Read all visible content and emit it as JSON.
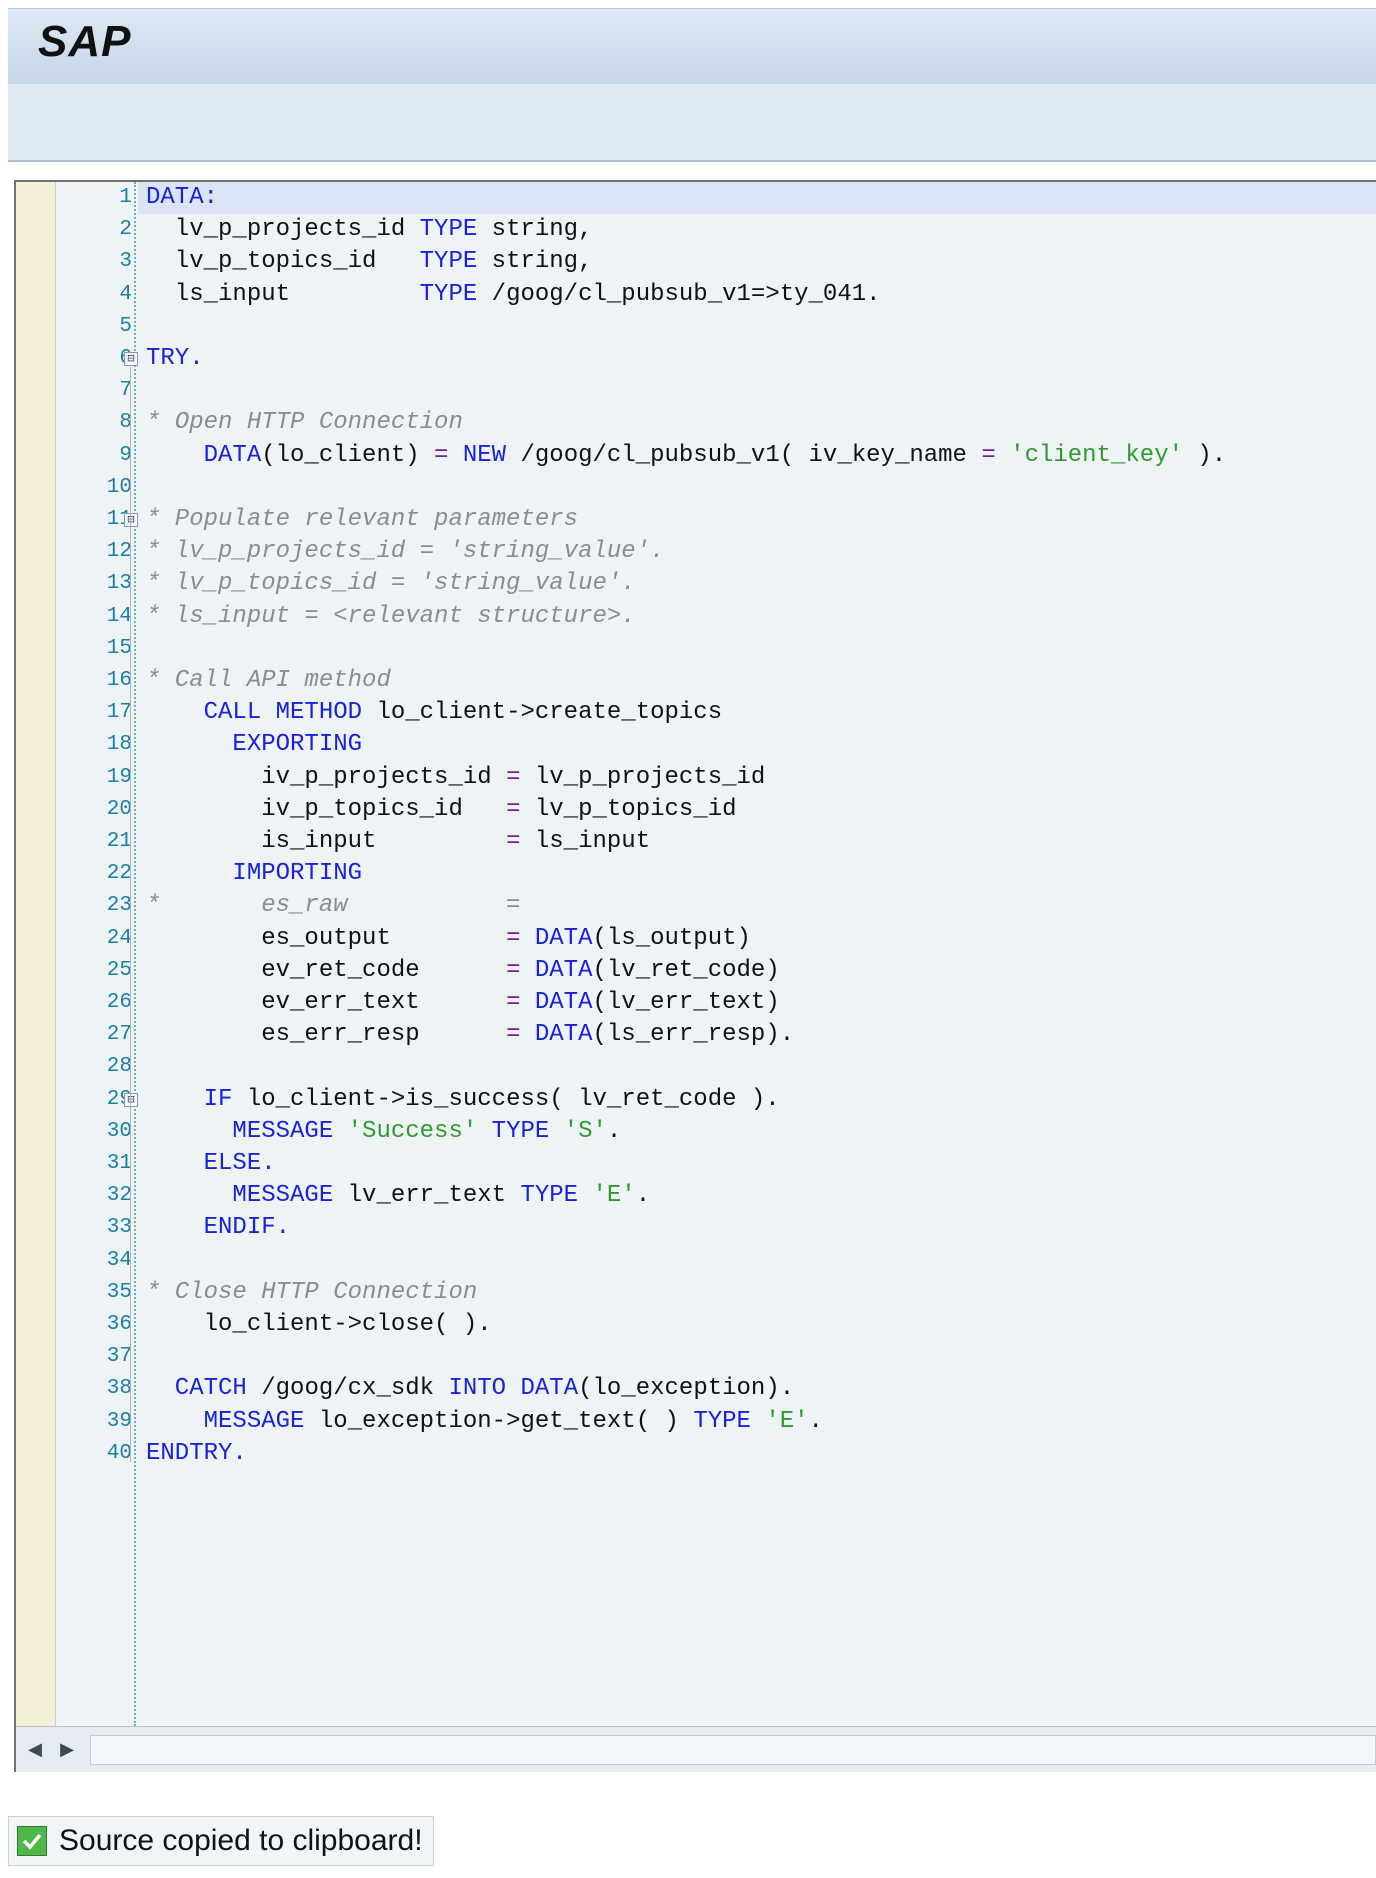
{
  "window": {
    "logo_text": "SAP"
  },
  "editor": {
    "current_line": 1,
    "lines": [
      {
        "n": "1",
        "tokens": [
          [
            "kw",
            "DATA:"
          ]
        ]
      },
      {
        "n": "2",
        "tokens": [
          [
            "id",
            "  lv_p_projects_id "
          ],
          [
            "kw",
            "TYPE"
          ],
          [
            "id",
            " string,"
          ]
        ]
      },
      {
        "n": "3",
        "tokens": [
          [
            "id",
            "  lv_p_topics_id   "
          ],
          [
            "kw",
            "TYPE"
          ],
          [
            "id",
            " string,"
          ]
        ]
      },
      {
        "n": "4",
        "tokens": [
          [
            "id",
            "  ls_input         "
          ],
          [
            "kw",
            "TYPE"
          ],
          [
            "id",
            " /goog/cl_pubsub_v1=>ty_041."
          ]
        ]
      },
      {
        "n": "5",
        "tokens": []
      },
      {
        "n": "6",
        "tokens": [
          [
            "kw",
            "TRY."
          ]
        ]
      },
      {
        "n": "7",
        "tokens": []
      },
      {
        "n": "8",
        "tokens": [
          [
            "cm",
            "* Open HTTP Connection"
          ]
        ]
      },
      {
        "n": "9",
        "tokens": [
          [
            "kw",
            "    DATA"
          ],
          [
            "id",
            "(lo_client) "
          ],
          [
            "op",
            "="
          ],
          [
            "id",
            " "
          ],
          [
            "kw",
            "NEW"
          ],
          [
            "id",
            " /goog/cl_pubsub_v1( iv_key_name "
          ],
          [
            "op",
            "="
          ],
          [
            "id",
            " "
          ],
          [
            "str",
            "'client_key'"
          ],
          [
            "id",
            " )."
          ]
        ]
      },
      {
        "n": "10",
        "tokens": []
      },
      {
        "n": "11",
        "tokens": [
          [
            "cm",
            "* Populate relevant parameters"
          ]
        ]
      },
      {
        "n": "12",
        "tokens": [
          [
            "cm",
            "* lv_p_projects_id = 'string_value'."
          ]
        ]
      },
      {
        "n": "13",
        "tokens": [
          [
            "cm",
            "* lv_p_topics_id = 'string_value'."
          ]
        ]
      },
      {
        "n": "14",
        "tokens": [
          [
            "cm",
            "* ls_input = <relevant structure>."
          ]
        ]
      },
      {
        "n": "15",
        "tokens": []
      },
      {
        "n": "16",
        "tokens": [
          [
            "cm",
            "* Call API method"
          ]
        ]
      },
      {
        "n": "17",
        "tokens": [
          [
            "kw",
            "    CALL METHOD"
          ],
          [
            "id",
            " lo_client->create_topics"
          ]
        ]
      },
      {
        "n": "18",
        "tokens": [
          [
            "kw",
            "      EXPORTING"
          ]
        ]
      },
      {
        "n": "19",
        "tokens": [
          [
            "id",
            "        iv_p_projects_id "
          ],
          [
            "op",
            "="
          ],
          [
            "id",
            " lv_p_projects_id"
          ]
        ]
      },
      {
        "n": "20",
        "tokens": [
          [
            "id",
            "        iv_p_topics_id   "
          ],
          [
            "op",
            "="
          ],
          [
            "id",
            " lv_p_topics_id"
          ]
        ]
      },
      {
        "n": "21",
        "tokens": [
          [
            "id",
            "        is_input         "
          ],
          [
            "op",
            "="
          ],
          [
            "id",
            " ls_input"
          ]
        ]
      },
      {
        "n": "22",
        "tokens": [
          [
            "kw",
            "      IMPORTING"
          ]
        ]
      },
      {
        "n": "23",
        "tokens": [
          [
            "cm",
            "*       es_raw           ="
          ]
        ]
      },
      {
        "n": "24",
        "tokens": [
          [
            "id",
            "        es_output        "
          ],
          [
            "op",
            "="
          ],
          [
            "id",
            " "
          ],
          [
            "kw",
            "DATA"
          ],
          [
            "id",
            "(ls_output)"
          ]
        ]
      },
      {
        "n": "25",
        "tokens": [
          [
            "id",
            "        ev_ret_code      "
          ],
          [
            "op",
            "="
          ],
          [
            "id",
            " "
          ],
          [
            "kw",
            "DATA"
          ],
          [
            "id",
            "(lv_ret_code)"
          ]
        ]
      },
      {
        "n": "26",
        "tokens": [
          [
            "id",
            "        ev_err_text      "
          ],
          [
            "op",
            "="
          ],
          [
            "id",
            " "
          ],
          [
            "kw",
            "DATA"
          ],
          [
            "id",
            "(lv_err_text)"
          ]
        ]
      },
      {
        "n": "27",
        "tokens": [
          [
            "id",
            "        es_err_resp      "
          ],
          [
            "op",
            "="
          ],
          [
            "id",
            " "
          ],
          [
            "kw",
            "DATA"
          ],
          [
            "id",
            "(ls_err_resp)."
          ]
        ]
      },
      {
        "n": "28",
        "tokens": []
      },
      {
        "n": "29",
        "tokens": [
          [
            "kw",
            "    IF"
          ],
          [
            "id",
            " lo_client->is_success( lv_ret_code )."
          ]
        ]
      },
      {
        "n": "30",
        "tokens": [
          [
            "kw",
            "      MESSAGE"
          ],
          [
            "id",
            " "
          ],
          [
            "str",
            "'Success'"
          ],
          [
            "id",
            " "
          ],
          [
            "kw",
            "TYPE"
          ],
          [
            "id",
            " "
          ],
          [
            "str",
            "'S'"
          ],
          [
            "id",
            "."
          ]
        ]
      },
      {
        "n": "31",
        "tokens": [
          [
            "kw",
            "    ELSE."
          ]
        ]
      },
      {
        "n": "32",
        "tokens": [
          [
            "kw",
            "      MESSAGE"
          ],
          [
            "id",
            " lv_err_text "
          ],
          [
            "kw",
            "TYPE"
          ],
          [
            "id",
            " "
          ],
          [
            "str",
            "'E'"
          ],
          [
            "id",
            "."
          ]
        ]
      },
      {
        "n": "33",
        "tokens": [
          [
            "kw",
            "    ENDIF."
          ]
        ]
      },
      {
        "n": "34",
        "tokens": []
      },
      {
        "n": "35",
        "tokens": [
          [
            "cm",
            "* Close HTTP Connection"
          ]
        ]
      },
      {
        "n": "36",
        "tokens": [
          [
            "id",
            "    lo_client->close( )."
          ]
        ]
      },
      {
        "n": "37",
        "tokens": []
      },
      {
        "n": "38",
        "tokens": [
          [
            "kw",
            "  CATCH"
          ],
          [
            "id",
            " /goog/cx_sdk "
          ],
          [
            "kw",
            "INTO"
          ],
          [
            "id",
            " "
          ],
          [
            "kw",
            "DATA"
          ],
          [
            "id",
            "(lo_exception)."
          ]
        ]
      },
      {
        "n": "39",
        "tokens": [
          [
            "kw",
            "    MESSAGE"
          ],
          [
            "id",
            " lo_exception->get_text( ) "
          ],
          [
            "kw",
            "TYPE"
          ],
          [
            "id",
            " "
          ],
          [
            "str",
            "'E'"
          ],
          [
            "id",
            "."
          ]
        ]
      },
      {
        "n": "40",
        "tokens": [
          [
            "kw",
            "ENDTRY."
          ]
        ]
      }
    ],
    "fold_markers": [
      {
        "line": 6,
        "symbol": "⊟"
      },
      {
        "line": 11,
        "symbol": "⊟"
      },
      {
        "line": 29,
        "symbol": "⊟"
      }
    ]
  },
  "scrollbar": {
    "left_icon": "scroll-left-icon",
    "right_icon": "scroll-right-icon",
    "left_glyph": "◀",
    "right_glyph": "▶"
  },
  "status": {
    "icon": "checkmark-icon",
    "message": "Source copied to clipboard!"
  },
  "colors": {
    "keyword": "#1a22d8",
    "string": "#2f9a2f",
    "comment": "#8c8c8c",
    "line_number": "#1a7fa0"
  }
}
